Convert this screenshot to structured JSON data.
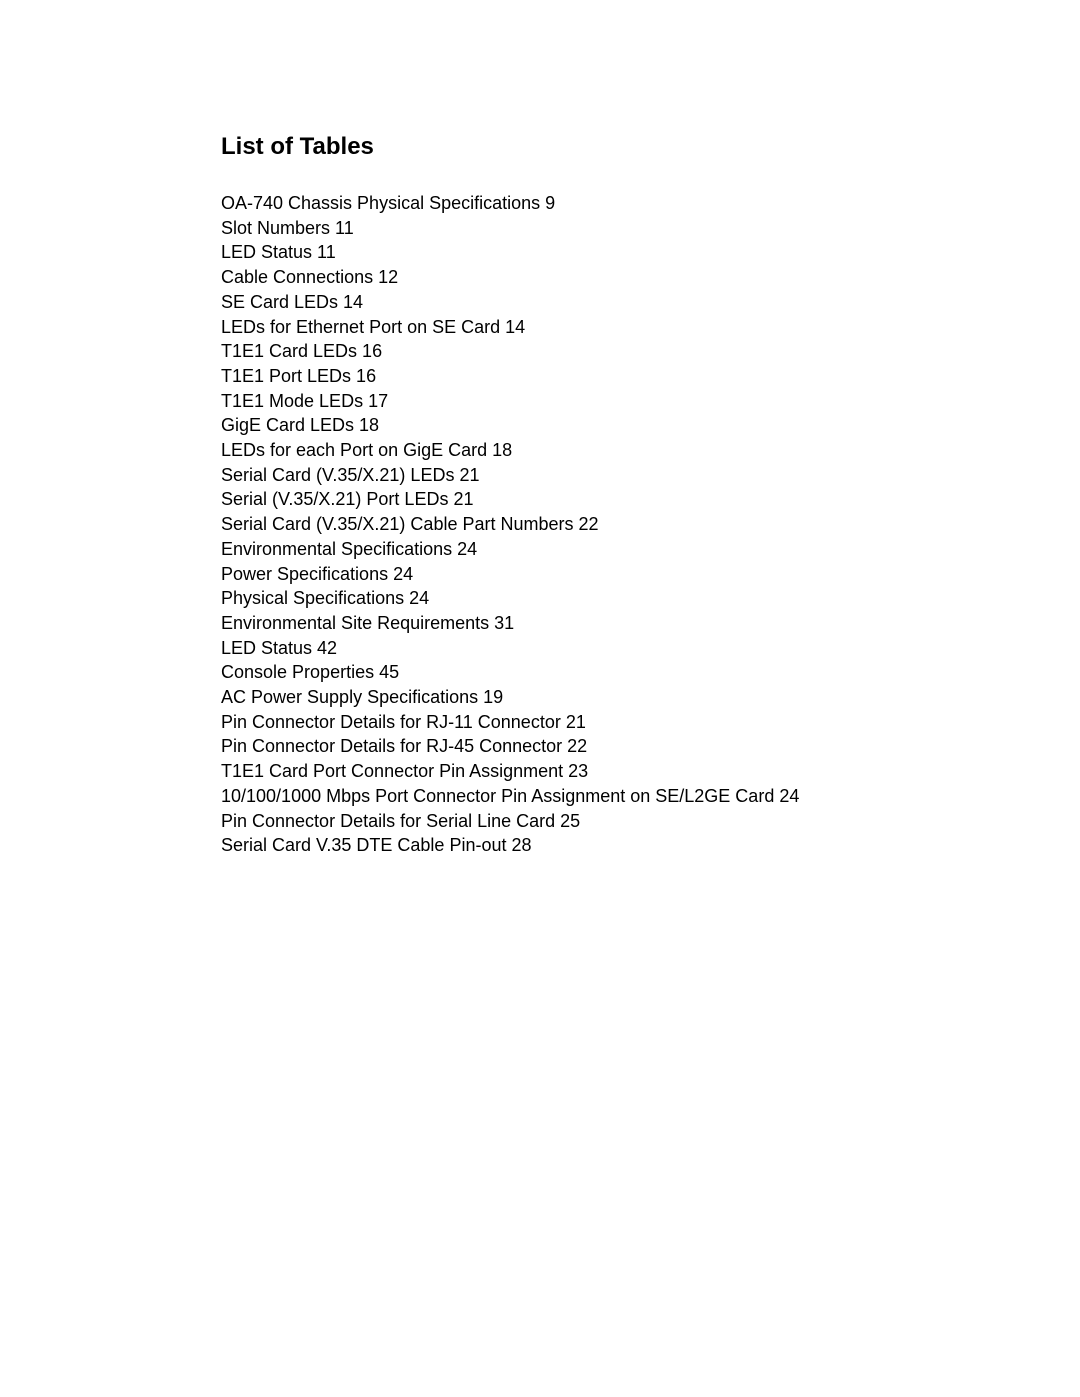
{
  "document": {
    "heading": "List of Tables",
    "background_color": "#ffffff",
    "text_color": "#000000"
  },
  "toc": {
    "entries": [
      {
        "title": "OA-740 Chassis Physical Specifications",
        "page": "9",
        "text": "OA-740 Chassis Physical Specifications 9"
      },
      {
        "title": "Slot Numbers",
        "page": "11",
        "text": "Slot Numbers 11"
      },
      {
        "title": "LED Status",
        "page": "11",
        "text": "LED Status 11"
      },
      {
        "title": "Cable Connections",
        "page": "12",
        "text": "Cable Connections 12"
      },
      {
        "title": "SE Card LEDs",
        "page": "14",
        "text": "SE Card LEDs 14"
      },
      {
        "title": "LEDs for Ethernet Port on SE Card",
        "page": "14",
        "text": "LEDs for Ethernet Port on SE Card 14"
      },
      {
        "title": "T1E1 Card LEDs",
        "page": "16",
        "text": "T1E1 Card LEDs 16"
      },
      {
        "title": "T1E1 Port LEDs",
        "page": "16",
        "text": "T1E1 Port LEDs 16"
      },
      {
        "title": "T1E1 Mode LEDs",
        "page": "17",
        "text": "T1E1 Mode LEDs 17"
      },
      {
        "title": "GigE Card LEDs",
        "page": "18",
        "text": "GigE Card LEDs 18"
      },
      {
        "title": "LEDs for each Port on GigE Card",
        "page": "18",
        "text": "LEDs for each Port on GigE Card 18"
      },
      {
        "title": "Serial Card (V.35/X.21) LEDs",
        "page": "21",
        "text": "Serial Card (V.35/X.21) LEDs 21"
      },
      {
        "title": "Serial (V.35/X.21) Port LEDs",
        "page": "21",
        "text": "Serial (V.35/X.21) Port LEDs 21"
      },
      {
        "title": "Serial Card (V.35/X.21) Cable Part Numbers",
        "page": "22",
        "text": "Serial Card (V.35/X.21) Cable Part Numbers 22"
      },
      {
        "title": "Environmental Specifications",
        "page": "24",
        "text": "Environmental Specifications 24"
      },
      {
        "title": "Power Specifications",
        "page": "24",
        "text": "Power Specifications 24"
      },
      {
        "title": "Physical Specifications",
        "page": "24",
        "text": "Physical Specifications 24"
      },
      {
        "title": "Environmental Site Requirements",
        "page": "31",
        "text": "Environmental Site Requirements 31"
      },
      {
        "title": "LED Status",
        "page": "42",
        "text": "LED Status 42"
      },
      {
        "title": "Console Properties",
        "page": "45",
        "text": "Console Properties 45"
      },
      {
        "title": "AC Power Supply Specifications",
        "page": "19",
        "text": "AC Power Supply Specifications 19"
      },
      {
        "title": "Pin Connector Details for RJ-11 Connector",
        "page": "21",
        "text": "Pin Connector Details for RJ-11 Connector 21"
      },
      {
        "title": "Pin Connector Details for RJ-45 Connector",
        "page": "22",
        "text": "Pin Connector Details for RJ-45 Connector 22"
      },
      {
        "title": "T1E1 Card Port Connector Pin Assignment",
        "page": "23",
        "text": "T1E1 Card Port Connector Pin Assignment 23"
      },
      {
        "title": "10/100/1000 Mbps Port Connector Pin Assignment on SE/L2GE Card",
        "page": "24",
        "text": "10/100/1000 Mbps Port Connector Pin Assignment on SE/L2GE Card 24"
      },
      {
        "title": "Pin Connector Details for Serial Line Card",
        "page": "25",
        "text": "Pin Connector Details for Serial Line Card 25"
      },
      {
        "title": "Serial Card V.35 DTE Cable Pin-out",
        "page": "28",
        "text": "Serial Card V.35 DTE Cable Pin-out 28"
      }
    ]
  }
}
